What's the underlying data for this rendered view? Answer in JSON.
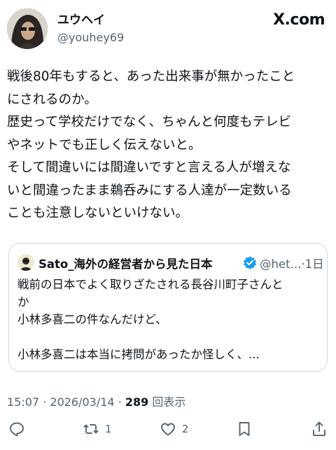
{
  "author": {
    "display_name": "ユウヘイ",
    "handle": "@youhey69"
  },
  "brand": "X.com",
  "tweet": {
    "lines": [
      "戦後80年もすると、あった出来事が無かったこと",
      "にされるのか。",
      "歴史って学校だけでなく、ちゃんと何度もテレビ",
      "やネットでも正しく伝えないと。",
      "そして間違いには間違いですと言える人が増えな",
      "いと間違ったまま鵜呑みにする人達が一定数いる",
      "ことも注意しないといけない。"
    ]
  },
  "quote": {
    "name": "Sato_海外の経営者から見た日本",
    "handle": "@het...",
    "separator": "·",
    "age": "1日",
    "lines": [
      "戦前の日本でよく取りざたされる長谷川町子さんと",
      "か",
      "小林多喜二の件なんだけど、",
      "",
      "小林多喜二は本当に拷問があったか怪しく、..."
    ]
  },
  "meta": {
    "time": "15:07",
    "dot": "·",
    "date": "2026/03/14",
    "views_count": "289",
    "views_label": "回表示"
  },
  "actions": {
    "reply_icon": "speech-bubble",
    "retweet_icon": "retweet-arrows",
    "retweet_count": "1",
    "like_icon": "heart",
    "like_count": "2",
    "bookmark_icon": "bookmark",
    "share_icon": "share-upload"
  },
  "colors": {
    "text": "#0f1419",
    "secondary": "#536471",
    "border": "#cfd9de",
    "verified": "#1d9bf0"
  }
}
